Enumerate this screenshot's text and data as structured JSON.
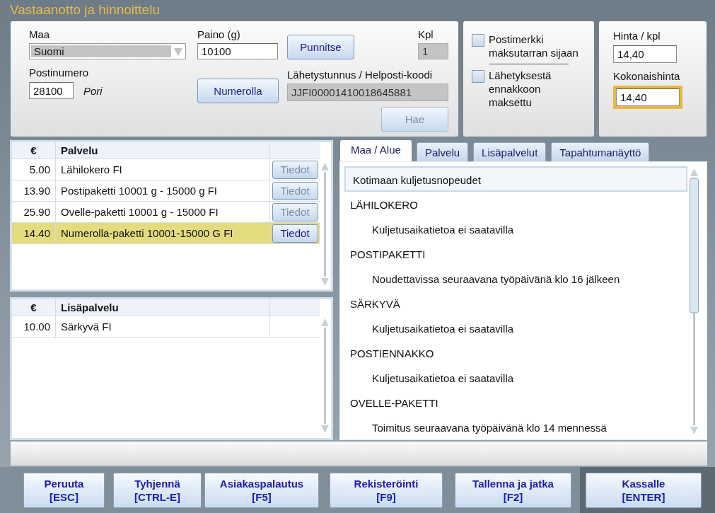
{
  "window": {
    "title": "Vastaanotto ja hinnoittelu"
  },
  "shipment": {
    "country": {
      "label": "Maa",
      "value": "Suomi",
      "disabled": true
    },
    "weight": {
      "label": "Paino (g)",
      "value": "10100"
    },
    "weigh_button": "Punnitse",
    "quantity": {
      "label": "Kpl",
      "value": "1",
      "disabled": true
    },
    "postal_code": {
      "label": "Postinumero",
      "value": "28100",
      "city": "Pori"
    },
    "number_button": "Numerolla",
    "tracking": {
      "label": "Lähetystunnus / Helposti-koodi",
      "value": "JJFI00001410018645881",
      "disabled": true
    },
    "fetch_button": {
      "label": "Hae",
      "disabled": true
    }
  },
  "options": [
    {
      "label": "Postimerkki maksutarran sijaan",
      "checked": false
    },
    {
      "label": "Lähetyksestä ennakkoon maksettu",
      "checked": false
    }
  ],
  "price": {
    "unit": {
      "label": "Hinta / kpl",
      "value": "14,40",
      "focused": false
    },
    "total": {
      "label": "Kokonaishinta",
      "value": "14,40",
      "focused": true
    }
  },
  "services_table": {
    "columns": [
      "€",
      "Palvelu"
    ],
    "rows": [
      {
        "price": "5.00",
        "name": "Lähilokero FI",
        "button": {
          "label": "Tiedot",
          "disabled": true
        },
        "selected": false
      },
      {
        "price": "13.90",
        "name": "Postipaketti 10001 g - 15000 g FI",
        "button": {
          "label": "Tiedot",
          "disabled": true
        },
        "selected": false
      },
      {
        "price": "25.90",
        "name": "Ovelle-paketti 10001 g - 15000  FI",
        "button": {
          "label": "Tiedot",
          "disabled": true
        },
        "selected": false
      },
      {
        "price": "14.40",
        "name": "Numerolla-paketti 10001-15000 G FI",
        "button": {
          "label": "Tiedot",
          "disabled": false
        },
        "selected": true
      }
    ]
  },
  "extras_table": {
    "columns": [
      "€",
      "Lisäpalvelu"
    ],
    "rows": [
      {
        "price": "10.00",
        "name": "Särkyvä FI",
        "selected": false
      }
    ]
  },
  "tabs": [
    {
      "label": "Maa / Alue",
      "selected": true
    },
    {
      "label": "Palvelu",
      "selected": false
    },
    {
      "label": "Lisäpalvelut",
      "selected": false
    },
    {
      "label": "Tapahtumanäyttö",
      "selected": false
    }
  ],
  "delivery_info": {
    "heading": "Kotimaan kuljetusnopeudet",
    "groups": [
      {
        "title": "LÄHILOKERO",
        "detail": "Kuljetusaikatietoa ei saatavilla"
      },
      {
        "title": "POSTIPAKETTI",
        "detail": "Noudettavissa seuraavana työpäivänä klo 16 jälkeen"
      },
      {
        "title": "SÄRKYVÄ",
        "detail": "Kuljetusaikatietoa ei saatavilla"
      },
      {
        "title": "POSTIENNAKKO",
        "detail": "Kuljetusaikatietoa ei saatavilla"
      },
      {
        "title": "OVELLE-PAKETTI",
        "detail": "Toimitus seuraavana työpäivänä klo 14 mennessä"
      }
    ]
  },
  "actions": [
    {
      "label": "Peruuta",
      "key": "[ESC]",
      "primary": false
    },
    {
      "label": "Tyhjennä",
      "key": "[CTRL-E]",
      "primary": false
    },
    {
      "label": "Asiakaspalautus",
      "key": "[F5]",
      "primary": false
    },
    {
      "label": "Rekisteröinti",
      "key": "[F9]",
      "primary": false
    },
    {
      "label": "Tallenna ja jatka",
      "key": "[F2]",
      "primary": false
    },
    {
      "label": "Kassalle",
      "key": "[ENTER]",
      "primary": true
    }
  ]
}
